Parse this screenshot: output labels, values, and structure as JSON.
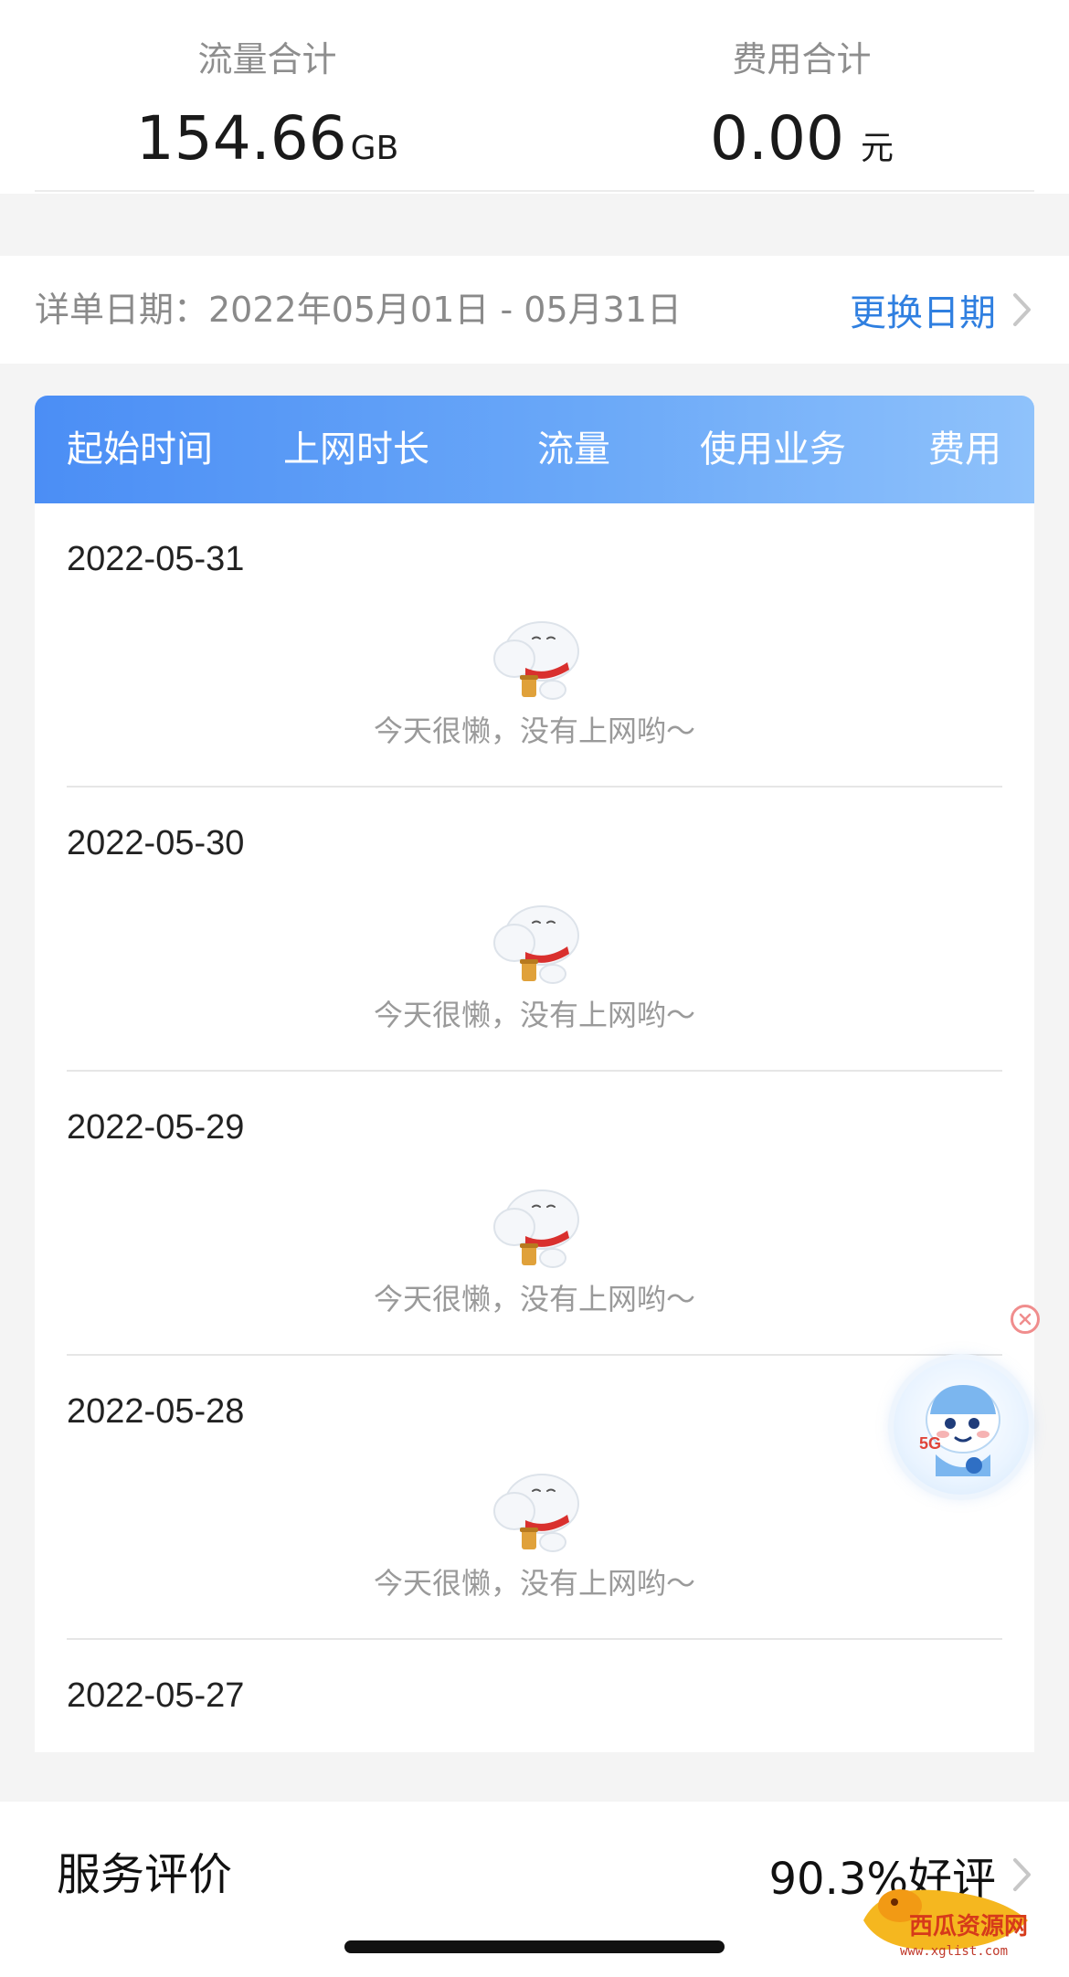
{
  "summary": {
    "traffic_label": "流量合计",
    "traffic_value": "154.66",
    "traffic_unit": "GB",
    "fee_label": "费用合计",
    "fee_value": "0.00",
    "fee_unit": "元"
  },
  "date_bar": {
    "range_text": "详单日期：2022年05月01日 - 05月31日",
    "change_label": "更换日期"
  },
  "table": {
    "headers": [
      "起始时间",
      "上网时长",
      "流量",
      "使用业务",
      "费用"
    ],
    "rows": [
      {
        "date": "2022-05-31",
        "message": "今天很懒，没有上网哟～"
      },
      {
        "date": "2022-05-30",
        "message": "今天很懒，没有上网哟～"
      },
      {
        "date": "2022-05-29",
        "message": "今天很懒，没有上网哟～"
      },
      {
        "date": "2022-05-28",
        "message": "今天很懒，没有上网哟～"
      },
      {
        "date": "2022-05-27",
        "message": ""
      }
    ]
  },
  "rating": {
    "label": "服务评价",
    "value": "90.3%好评"
  },
  "watermark": {
    "text": "西瓜资源网",
    "url": "www.xglist.com"
  },
  "colors": {
    "accent": "#2f7fe0",
    "header_gradient_start": "#4b8ef5",
    "header_gradient_end": "#8fc2fb"
  },
  "icons": {
    "mascot": "cloud-mascot-icon",
    "chevron": "chevron-right-icon",
    "close": "close-icon",
    "assistant": "assistant-bot-icon"
  }
}
